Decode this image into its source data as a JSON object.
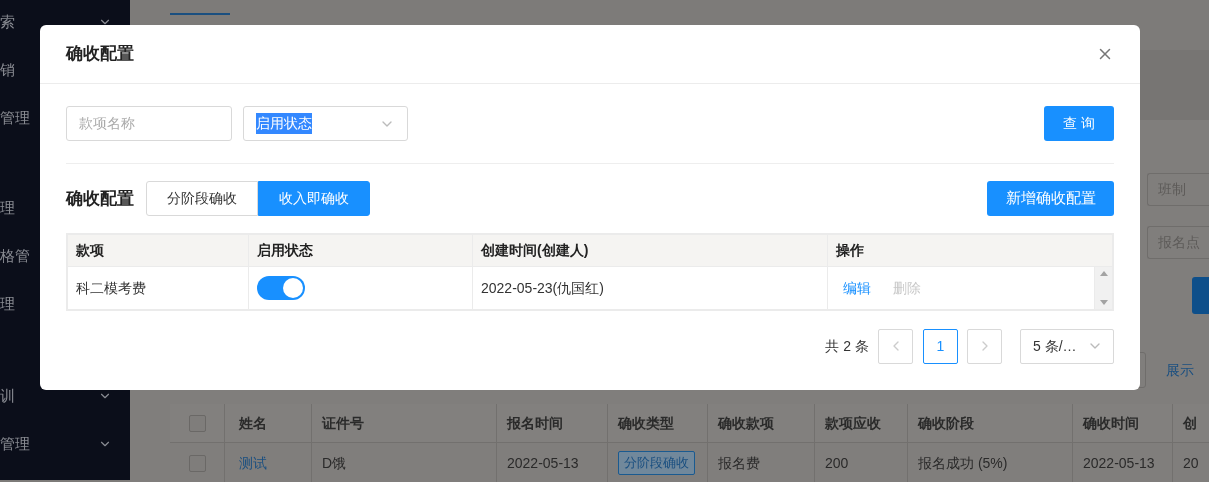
{
  "sidebar": {
    "items": [
      {
        "label": "索",
        "expandable": true
      },
      {
        "label": "销"
      },
      {
        "label": "管理"
      },
      {
        "label": "理"
      },
      {
        "label": "格管"
      },
      {
        "label": "理"
      },
      {
        "label": "训",
        "expandable": true
      },
      {
        "label": "管理",
        "expandable": true
      }
    ]
  },
  "background": {
    "filters": [
      {
        "placeholder": "班制"
      },
      {
        "placeholder": "报名点"
      }
    ],
    "link": "展示",
    "table": {
      "all_checked": false,
      "columns": [
        "姓名",
        "证件号",
        "报名时间",
        "确收类型",
        "确收款项",
        "款项应收",
        "确收阶段",
        "确收时间",
        "创"
      ],
      "rows": [
        {
          "checked": false,
          "cells": [
            "测试",
            "D饿",
            "2022-05-13",
            "分阶段确收",
            "报名费",
            "200",
            "报名成功 (5%)",
            "2022-05-13",
            "20"
          ]
        }
      ]
    }
  },
  "dialog": {
    "title": "确收配置",
    "filters": {
      "name_placeholder": "款项名称",
      "status_select": "启用状态",
      "query_button": "查 询"
    },
    "section_title": "确收配置",
    "segments": [
      {
        "label": "分阶段确收",
        "selected": false
      },
      {
        "label": "收入即确收",
        "selected": true
      }
    ],
    "add_button": "新增确收配置",
    "table": {
      "columns": [
        "款项",
        "启用状态",
        "创建时间(创建人)",
        "操作"
      ],
      "rows": [
        {
          "item": "科二模考费",
          "enabled": true,
          "created": "2022-05-23(仇国红)",
          "actions": [
            {
              "label": "编辑",
              "disabled": false
            },
            {
              "label": "删除",
              "disabled": true
            }
          ]
        }
      ]
    },
    "pagination": {
      "total": "共 2 条",
      "pages": [
        {
          "label": "1",
          "selected": true
        }
      ],
      "page_size": "5 条/…"
    }
  }
}
